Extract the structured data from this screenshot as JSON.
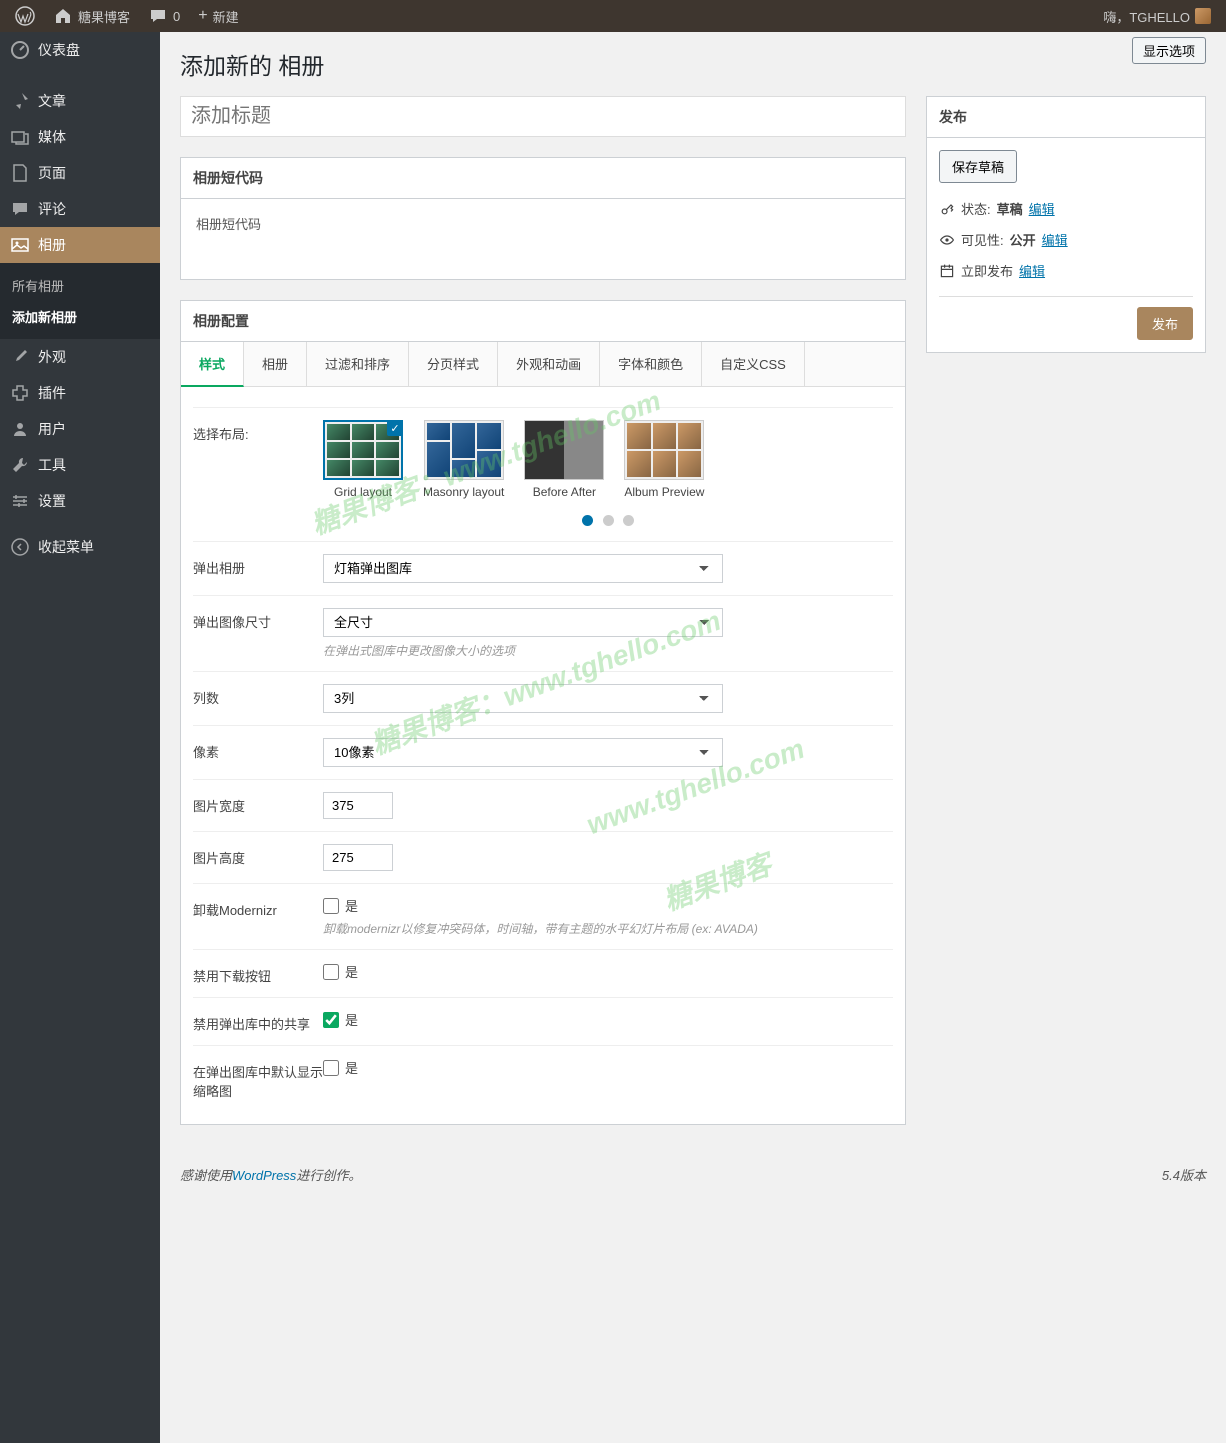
{
  "toolbar": {
    "site": "糖果博客",
    "comments": "0",
    "new": "新建",
    "greeting": "嗨，TGHELLO"
  },
  "sidebar": {
    "items": [
      {
        "label": "仪表盘"
      },
      {
        "label": "文章"
      },
      {
        "label": "媒体"
      },
      {
        "label": "页面"
      },
      {
        "label": "评论"
      },
      {
        "label": "相册"
      },
      {
        "label": "外观"
      },
      {
        "label": "插件"
      },
      {
        "label": "用户"
      },
      {
        "label": "工具"
      },
      {
        "label": "设置"
      },
      {
        "label": "收起菜单"
      }
    ],
    "submenu": {
      "all": "所有相册",
      "add": "添加新相册"
    }
  },
  "page": {
    "title": "添加新的 相册",
    "show_options": "显示选项",
    "title_placeholder": "添加标题"
  },
  "publish": {
    "heading": "发布",
    "save_draft": "保存草稿",
    "status_label": "状态:",
    "status_value": "草稿",
    "edit": "编辑",
    "visibility_label": "可见性:",
    "visibility_value": "公开",
    "schedule": "立即发布",
    "publish_btn": "发布"
  },
  "shortcode": {
    "heading": "相册短代码",
    "text": "相册短代码"
  },
  "config": {
    "heading": "相册配置",
    "tabs": [
      "样式",
      "相册",
      "过滤和排序",
      "分页样式",
      "外观和动画",
      "字体和颜色",
      "自定义CSS"
    ],
    "layout": {
      "label": "选择布局:",
      "opts": [
        "Grid layout",
        "Masonry layout",
        "Before After",
        "Album Preview"
      ]
    },
    "popup": {
      "label": "弹出相册",
      "value": "灯箱弹出图库"
    },
    "popup_size": {
      "label": "弹出图像尺寸",
      "value": "全尺寸",
      "hint": "在弹出式图库中更改图像大小的选项"
    },
    "columns": {
      "label": "列数",
      "value": "3列"
    },
    "pixels": {
      "label": "像素",
      "value": "10像素"
    },
    "width": {
      "label": "图片宽度",
      "value": "375"
    },
    "height": {
      "label": "图片高度",
      "value": "275"
    },
    "modernizr": {
      "label": "卸载Modernizr",
      "yes": "是",
      "hint": "卸载modernizr以修复冲突码体，时间轴，带有主题的水平幻灯片布局 (ex: AVADA)"
    },
    "disable_download": {
      "label": "禁用下载按钮",
      "yes": "是"
    },
    "disable_share": {
      "label": "禁用弹出库中的共享",
      "yes": "是"
    },
    "default_thumbs": {
      "label": "在弹出图库中默认显示缩略图",
      "yes": "是"
    }
  },
  "footer": {
    "thanks": "感谢使用",
    "wp": "WordPress",
    "create": "进行创作。",
    "version": "5.4版本"
  }
}
